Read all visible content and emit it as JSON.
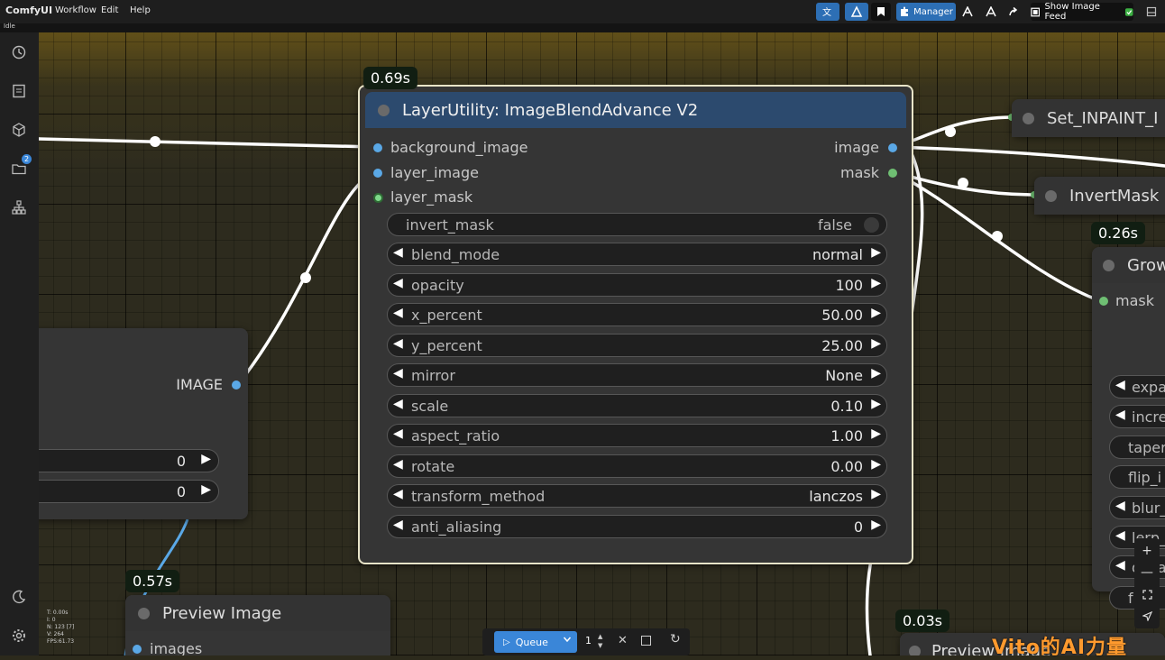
{
  "app": {
    "brand": "ComfyUI",
    "status": "Idle"
  },
  "menu": [
    "Workflow",
    "Edit",
    "Help"
  ],
  "toolbar": {
    "manager": "Manager",
    "show_image_feed": "Show Image Feed"
  },
  "sidebar": {
    "badge": "2"
  },
  "main_node": {
    "time": "0.69s",
    "title": "LayerUtility: ImageBlendAdvance V2",
    "inputs": [
      "background_image",
      "layer_image",
      "layer_mask"
    ],
    "outputs": [
      "image",
      "mask"
    ],
    "toggle": {
      "label": "invert_mask",
      "value": "false"
    },
    "widgets": [
      {
        "label": "blend_mode",
        "value": "normal"
      },
      {
        "label": "opacity",
        "value": "100"
      },
      {
        "label": "x_percent",
        "value": "50.00"
      },
      {
        "label": "y_percent",
        "value": "25.00"
      },
      {
        "label": "mirror",
        "value": "None"
      },
      {
        "label": "scale",
        "value": "0.10"
      },
      {
        "label": "aspect_ratio",
        "value": "1.00"
      },
      {
        "label": "rotate",
        "value": "0.00"
      },
      {
        "label": "transform_method",
        "value": "lanczos"
      },
      {
        "label": "anti_aliasing",
        "value": "0"
      }
    ]
  },
  "left_node": {
    "output": "IMAGE",
    "widget1_value": "0",
    "widget2_value": "0"
  },
  "preview_node": {
    "time": "0.57s",
    "title": "Preview Image",
    "input": "images"
  },
  "preview_node2": {
    "time": "0.03s",
    "title": "Preview Image"
  },
  "set_node": {
    "title": "Set_INPAINT_I"
  },
  "invert_node": {
    "title": "InvertMask"
  },
  "grow_node": {
    "time": "0.26s",
    "title": "Grow",
    "input": "mask",
    "widgets": [
      "expa",
      "incre",
      "taper",
      "flip_i",
      "blur_",
      "lerp_",
      "deca",
      "f"
    ]
  },
  "queue": {
    "label": "Queue",
    "count": "1"
  },
  "perf": [
    "T: 0.00s",
    "I: 0",
    "N: 123 [7]",
    "V: 264",
    "FPS:61.73"
  ],
  "watermark": "Vito的AI力量"
}
